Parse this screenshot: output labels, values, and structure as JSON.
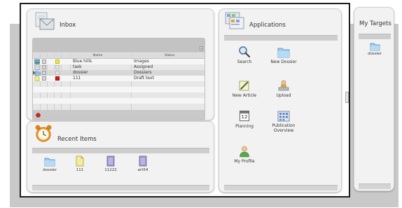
{
  "inbox": {
    "title": "Inbox",
    "columns": {
      "name": "Name",
      "status": "Status"
    },
    "rows": [
      {
        "name": "Blue hills",
        "status": "Images",
        "flag": "#f5e93d"
      },
      {
        "name": "task",
        "status": "Assigned",
        "flag": ""
      },
      {
        "name": "dossier",
        "status": "Dossiers",
        "flag": ""
      },
      {
        "name": "111",
        "status": "Draft text",
        "flag": "#dd1a1a"
      }
    ]
  },
  "recent": {
    "title": "Recent Items",
    "items": [
      {
        "label": "dossier",
        "icon": "folder-icon"
      },
      {
        "label": "111",
        "icon": "document-yellow-icon"
      },
      {
        "label": "11222",
        "icon": "document-purple-icon"
      },
      {
        "label": "art54",
        "icon": "document-purple-icon"
      }
    ]
  },
  "applications": {
    "title": "Applications",
    "items": [
      {
        "label": "Search",
        "icon": "magnifier-icon"
      },
      {
        "label": "New Dossier",
        "icon": "folder-icon"
      },
      {
        "label": "New Article",
        "icon": "pen-paper-icon"
      },
      {
        "label": "Upload",
        "icon": "upload-icon"
      },
      {
        "label": "Planning",
        "icon": "calendar-icon",
        "calendar_day": "12"
      },
      {
        "label": "Publication Overview",
        "icon": "grid-icon"
      },
      {
        "label": "My Profile",
        "icon": "user-icon"
      }
    ]
  },
  "targets": {
    "title": "My Targets",
    "items": [
      {
        "label": "dossier",
        "icon": "folder-icon"
      }
    ]
  }
}
